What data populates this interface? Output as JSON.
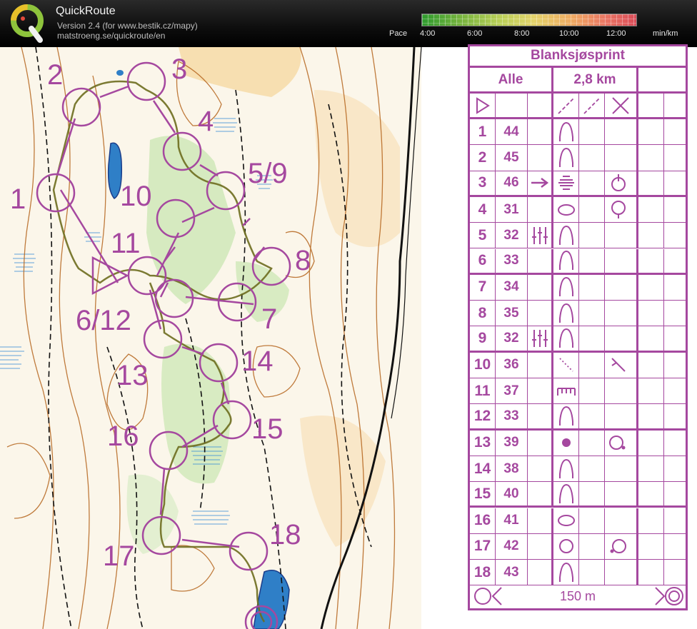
{
  "app": {
    "title": "QuickRoute",
    "version": "Version 2.4  (for www.bestik.cz/mapy)",
    "url": "matstroeng.se/quickroute/en"
  },
  "pace": {
    "label": "Pace",
    "unit": "min/km",
    "ticks": [
      "4:00",
      "6:00",
      "8:00",
      "10:00",
      "12:00"
    ]
  },
  "map": {
    "control_labels": [
      "1",
      "2",
      "3",
      "4",
      "5/9",
      "6/12",
      "7",
      "8",
      "10",
      "11",
      "13",
      "14",
      "15",
      "16",
      "17",
      "18"
    ]
  },
  "description": {
    "event": "Blanksjøsprint",
    "class": "Alle",
    "length": "2,8 km",
    "finish_distance": "150 m",
    "controls": [
      {
        "num": "1",
        "code": "44",
        "feature": "reentrant",
        "extra": "",
        "appearance": "",
        "other": ""
      },
      {
        "num": "2",
        "code": "45",
        "feature": "reentrant",
        "extra": "",
        "appearance": "",
        "other": ""
      },
      {
        "num": "3",
        "code": "46",
        "feature": "marsh",
        "extra": "arrow",
        "appearance": "",
        "other": "bottom-circle"
      },
      {
        "num": "4",
        "code": "31",
        "feature": "oval",
        "extra": "",
        "appearance": "",
        "other": "top-circle"
      },
      {
        "num": "5",
        "code": "32",
        "feature": "reentrant",
        "extra": "",
        "appearance": "gully-bars",
        "other": ""
      },
      {
        "num": "6",
        "code": "33",
        "feature": "reentrant",
        "extra": "",
        "appearance": "",
        "other": ""
      },
      {
        "num": "7",
        "code": "34",
        "feature": "reentrant",
        "extra": "",
        "appearance": "",
        "other": ""
      },
      {
        "num": "8",
        "code": "35",
        "feature": "reentrant",
        "extra": "",
        "appearance": "",
        "other": ""
      },
      {
        "num": "9",
        "code": "32",
        "feature": "reentrant",
        "extra": "",
        "appearance": "gully-bars",
        "other": ""
      },
      {
        "num": "10",
        "code": "36",
        "feature": "path-end",
        "extra": "",
        "appearance": "",
        "other": "hook"
      },
      {
        "num": "11",
        "code": "37",
        "feature": "fence",
        "extra": "",
        "appearance": "",
        "other": ""
      },
      {
        "num": "12",
        "code": "33",
        "feature": "reentrant",
        "extra": "",
        "appearance": "",
        "other": ""
      },
      {
        "num": "13",
        "code": "39",
        "feature": "dot",
        "extra": "",
        "appearance": "",
        "other": "right-circle"
      },
      {
        "num": "14",
        "code": "38",
        "feature": "reentrant",
        "extra": "",
        "appearance": "",
        "other": ""
      },
      {
        "num": "15",
        "code": "40",
        "feature": "reentrant",
        "extra": "",
        "appearance": "",
        "other": ""
      },
      {
        "num": "16",
        "code": "41",
        "feature": "oval",
        "extra": "",
        "appearance": "",
        "other": ""
      },
      {
        "num": "17",
        "code": "42",
        "feature": "circle",
        "extra": "",
        "appearance": "",
        "other": "left-circle"
      },
      {
        "num": "18",
        "code": "43",
        "feature": "reentrant",
        "extra": "",
        "appearance": "",
        "other": ""
      }
    ]
  },
  "colors": {
    "course": "#a5489f",
    "route": "#7a7a2a"
  }
}
